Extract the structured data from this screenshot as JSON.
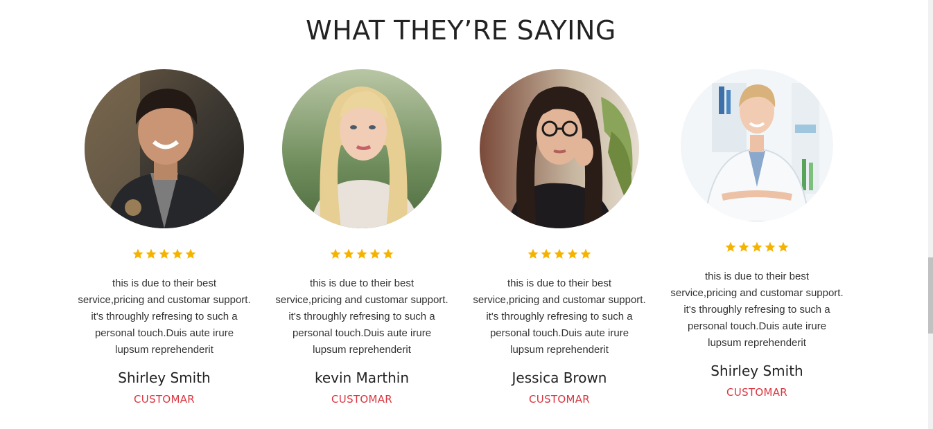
{
  "section": {
    "title": "WHAT THEY’RE SAYING"
  },
  "testimonials": [
    {
      "name": "Shirley Smith",
      "role": "CUSTOMAR",
      "rating": 5,
      "quote": "this is due to their best service,pricing and customar support. it's throughly refresing to such a personal touch.Duis aute irure lupsum reprehenderit"
    },
    {
      "name": "kevin Marthin",
      "role": "CUSTOMAR",
      "rating": 5,
      "quote": "this is due to their best service,pricing and customar support. it's throughly refresing to such a personal touch.Duis aute irure lupsum reprehenderit"
    },
    {
      "name": "Jessica Brown",
      "role": "CUSTOMAR",
      "rating": 5,
      "quote": "this is due to their best service,pricing and customar support. it's throughly refresing to such a personal touch.Duis aute irure lupsum reprehenderit"
    },
    {
      "name": "Shirley Smith",
      "role": "CUSTOMAR",
      "rating": 5,
      "quote": "this is due to their best service,pricing and customar support. it's throughly refresing to such a personal touch.Duis aute irure lupsum reprehenderit"
    }
  ],
  "colors": {
    "star": "#f5b301",
    "role": "#d9353e",
    "title": "#222222"
  },
  "icons": {
    "rating": "star-icon"
  }
}
